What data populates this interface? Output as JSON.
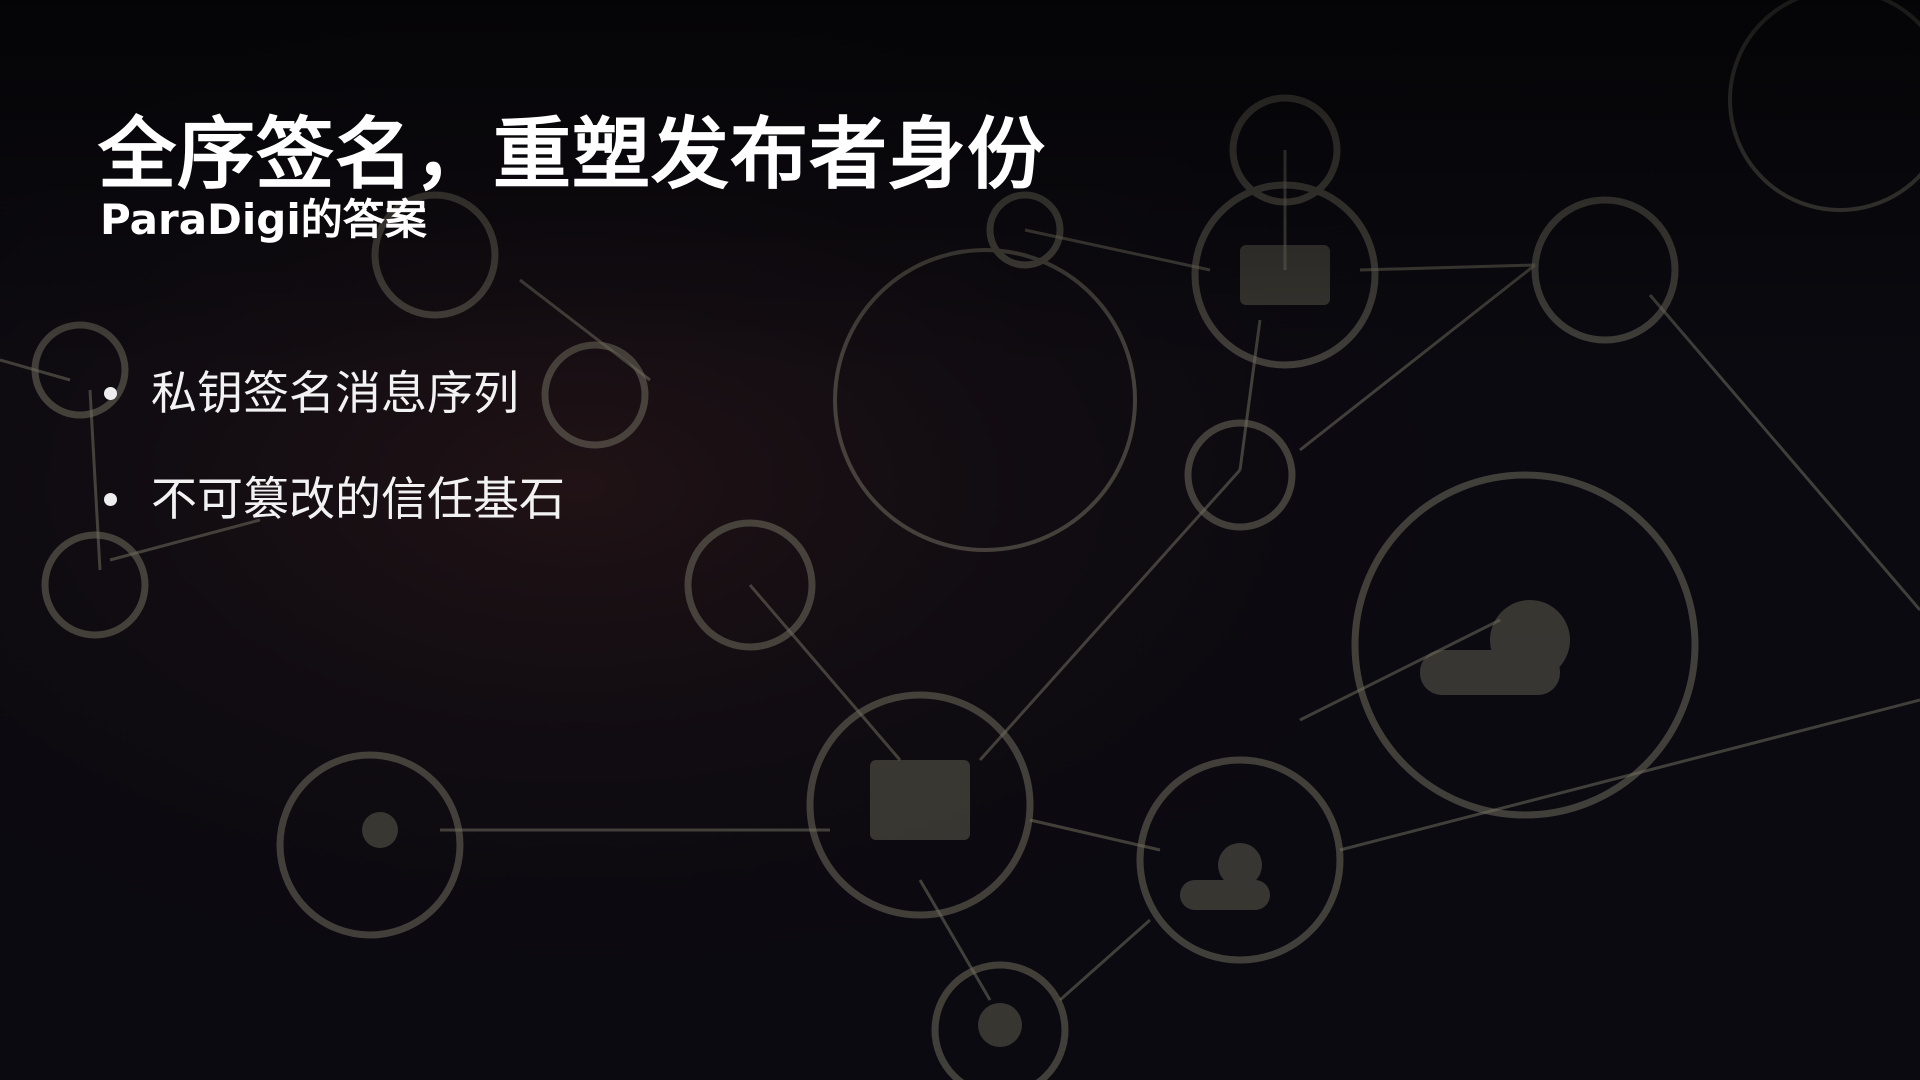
{
  "slide": {
    "title": "全序签名，重塑发布者身份",
    "subtitle": "ParaDigi的答案",
    "bullets": [
      {
        "text": "私钥签名消息序列"
      },
      {
        "text": "不可篡改的信任基石"
      }
    ]
  },
  "colors": {
    "background": "#0b0a10",
    "network": "#8a8672",
    "text": "#ffffff"
  }
}
